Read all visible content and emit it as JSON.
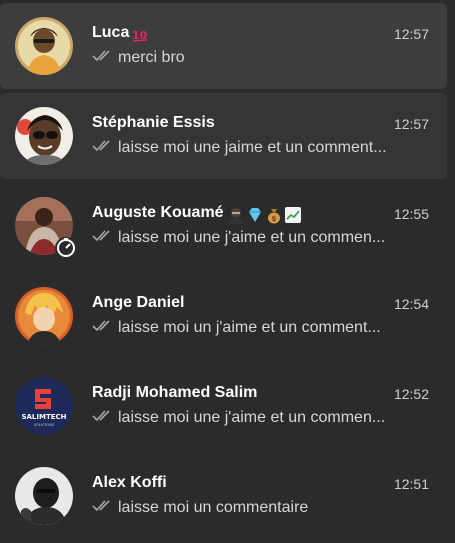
{
  "chats": [
    {
      "name": "Luca",
      "name_emoji_icons": [
        "hundred-points-icon"
      ],
      "time": "12:57",
      "preview": "merci bro",
      "tick_icon": "double-check-icon",
      "selected": true
    },
    {
      "name": "Stéphanie Essis",
      "name_emoji_icons": [],
      "time": "12:57",
      "preview": "laisse moi une jaime et un comment...",
      "tick_icon": "double-check-icon",
      "selected": false
    },
    {
      "name": "Auguste Kouamé",
      "name_emoji_icons": [
        "ninja-icon",
        "gem-icon",
        "money-bag-icon",
        "chart-increasing-icon"
      ],
      "time": "12:55",
      "preview": "laisse moi une j'aime et un commen...",
      "tick_icon": "double-check-icon",
      "status_icon": "status-timer-icon",
      "selected": false
    },
    {
      "name": "Ange Daniel",
      "name_emoji_icons": [],
      "time": "12:54",
      "preview": "laisse moi un j'aime et un comment...",
      "tick_icon": "double-check-icon",
      "selected": false
    },
    {
      "name": "Radji Mohamed Salim",
      "name_emoji_icons": [],
      "time": "12:52",
      "preview": "laisse moi une j'aime et un commen...",
      "tick_icon": "double-check-icon",
      "avatar_text": "SALIMTECH",
      "avatar_subtext": "SOLUTIONS",
      "selected": false
    },
    {
      "name": "Alex Koffi",
      "name_emoji_icons": [],
      "time": "12:51",
      "preview": "laisse moi un commentaire",
      "tick_icon": "double-check-icon",
      "selected": false
    }
  ],
  "colors": {
    "background": "#2b2b2b",
    "selected_row": "#3d3d3d",
    "hover_row": "#353535",
    "text_primary": "#ffffff",
    "text_secondary": "#d6d6d6"
  }
}
